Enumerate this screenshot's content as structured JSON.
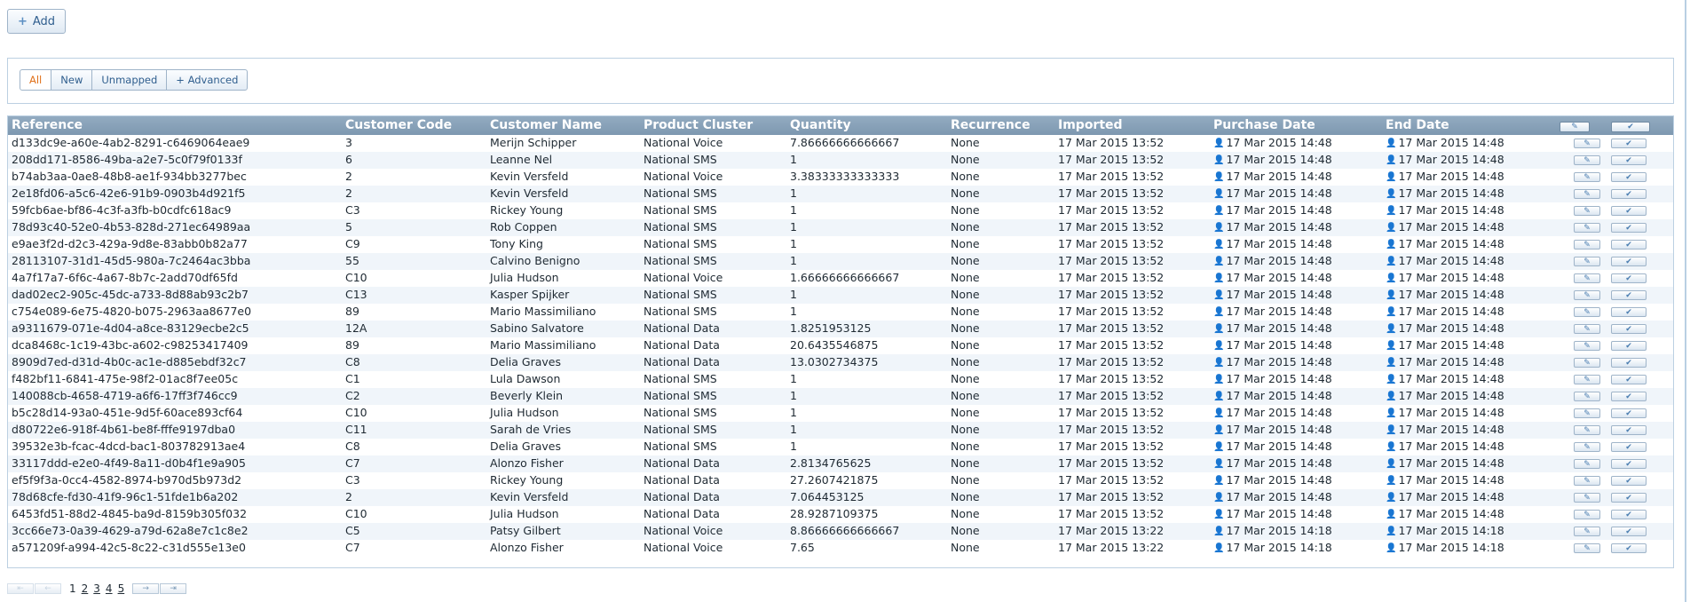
{
  "toolbar": {
    "add_label": "Add"
  },
  "filters": [
    {
      "label": "All",
      "active": true
    },
    {
      "label": "New",
      "active": false
    },
    {
      "label": "Unmapped",
      "active": false
    },
    {
      "label": "+ Advanced",
      "active": false
    }
  ],
  "table": {
    "columns": [
      "Reference",
      "Customer Code",
      "Customer Name",
      "Product Cluster",
      "Quantity",
      "Recurrence",
      "Imported",
      "Purchase Date",
      "End Date"
    ],
    "rows": [
      [
        "d133dc9e-a60e-4ab2-8291-c6469064eae9",
        "3",
        "Merijn Schipper",
        "National Voice",
        "7.86666666666667",
        "None",
        "17 Mar 2015 13:52",
        "17 Mar 2015 14:48",
        "17 Mar 2015 14:48"
      ],
      [
        "208dd171-8586-49ba-a2e7-5c0f79f0133f",
        "6",
        "Leanne Nel",
        "National SMS",
        "1",
        "None",
        "17 Mar 2015 13:52",
        "17 Mar 2015 14:48",
        "17 Mar 2015 14:48"
      ],
      [
        "b74ab3aa-0ae8-48b8-ae1f-934bb3277bec",
        "2",
        "Kevin Versfeld",
        "National Voice",
        "3.38333333333333",
        "None",
        "17 Mar 2015 13:52",
        "17 Mar 2015 14:48",
        "17 Mar 2015 14:48"
      ],
      [
        "2e18fd06-a5c6-42e6-91b9-0903b4d921f5",
        "2",
        "Kevin Versfeld",
        "National SMS",
        "1",
        "None",
        "17 Mar 2015 13:52",
        "17 Mar 2015 14:48",
        "17 Mar 2015 14:48"
      ],
      [
        "59fcb6ae-bf86-4c3f-a3fb-b0cdfc618ac9",
        "C3",
        "Rickey Young",
        "National SMS",
        "1",
        "None",
        "17 Mar 2015 13:52",
        "17 Mar 2015 14:48",
        "17 Mar 2015 14:48"
      ],
      [
        "78d93c40-52e0-4b53-828d-271ec64989aa",
        "5",
        "Rob Coppen",
        "National SMS",
        "1",
        "None",
        "17 Mar 2015 13:52",
        "17 Mar 2015 14:48",
        "17 Mar 2015 14:48"
      ],
      [
        "e9ae3f2d-d2c3-429a-9d8e-83abb0b82a77",
        "C9",
        "Tony King",
        "National SMS",
        "1",
        "None",
        "17 Mar 2015 13:52",
        "17 Mar 2015 14:48",
        "17 Mar 2015 14:48"
      ],
      [
        "28113107-31d1-45d5-980a-7c2464ac3bba",
        "55",
        "Calvino Benigno",
        "National SMS",
        "1",
        "None",
        "17 Mar 2015 13:52",
        "17 Mar 2015 14:48",
        "17 Mar 2015 14:48"
      ],
      [
        "4a7f17a7-6f6c-4a67-8b7c-2add70df65fd",
        "C10",
        "Julia Hudson",
        "National Voice",
        "1.66666666666667",
        "None",
        "17 Mar 2015 13:52",
        "17 Mar 2015 14:48",
        "17 Mar 2015 14:48"
      ],
      [
        "dad02ec2-905c-45dc-a733-8d88ab93c2b7",
        "C13",
        "Kasper Spijker",
        "National SMS",
        "1",
        "None",
        "17 Mar 2015 13:52",
        "17 Mar 2015 14:48",
        "17 Mar 2015 14:48"
      ],
      [
        "c754e089-6e75-4820-b075-2963aa8677e0",
        "89",
        "Mario Massimiliano",
        "National SMS",
        "1",
        "None",
        "17 Mar 2015 13:52",
        "17 Mar 2015 14:48",
        "17 Mar 2015 14:48"
      ],
      [
        "a9311679-071e-4d04-a8ce-83129ecbe2c5",
        "12A",
        "Sabino Salvatore",
        "National Data",
        "1.8251953125",
        "None",
        "17 Mar 2015 13:52",
        "17 Mar 2015 14:48",
        "17 Mar 2015 14:48"
      ],
      [
        "dca8468c-1c19-43bc-a602-c98253417409",
        "89",
        "Mario Massimiliano",
        "National Data",
        "20.6435546875",
        "None",
        "17 Mar 2015 13:52",
        "17 Mar 2015 14:48",
        "17 Mar 2015 14:48"
      ],
      [
        "8909d7ed-d31d-4b0c-ac1e-d885ebdf32c7",
        "C8",
        "Delia Graves",
        "National Data",
        "13.0302734375",
        "None",
        "17 Mar 2015 13:52",
        "17 Mar 2015 14:48",
        "17 Mar 2015 14:48"
      ],
      [
        "f482bf11-6841-475e-98f2-01ac8f7ee05c",
        "C1",
        "Lula Dawson",
        "National SMS",
        "1",
        "None",
        "17 Mar 2015 13:52",
        "17 Mar 2015 14:48",
        "17 Mar 2015 14:48"
      ],
      [
        "140088cb-4658-4719-a6f6-17ff3f746cc9",
        "C2",
        "Beverly Klein",
        "National SMS",
        "1",
        "None",
        "17 Mar 2015 13:52",
        "17 Mar 2015 14:48",
        "17 Mar 2015 14:48"
      ],
      [
        "b5c28d14-93a0-451e-9d5f-60ace893cf64",
        "C10",
        "Julia Hudson",
        "National SMS",
        "1",
        "None",
        "17 Mar 2015 13:52",
        "17 Mar 2015 14:48",
        "17 Mar 2015 14:48"
      ],
      [
        "d80722e6-918f-4b61-be8f-fffe9197dba0",
        "C11",
        "Sarah de Vries",
        "National SMS",
        "1",
        "None",
        "17 Mar 2015 13:52",
        "17 Mar 2015 14:48",
        "17 Mar 2015 14:48"
      ],
      [
        "39532e3b-fcac-4dcd-bac1-803782913ae4",
        "C8",
        "Delia Graves",
        "National SMS",
        "1",
        "None",
        "17 Mar 2015 13:52",
        "17 Mar 2015 14:48",
        "17 Mar 2015 14:48"
      ],
      [
        "33117ddd-e2e0-4f49-8a11-d0b4f1e9a905",
        "C7",
        "Alonzo Fisher",
        "National Data",
        "2.8134765625",
        "None",
        "17 Mar 2015 13:52",
        "17 Mar 2015 14:48",
        "17 Mar 2015 14:48"
      ],
      [
        "ef5f9f3a-0cc4-4582-8974-b970d5b973d2",
        "C3",
        "Rickey Young",
        "National Data",
        "27.2607421875",
        "None",
        "17 Mar 2015 13:52",
        "17 Mar 2015 14:48",
        "17 Mar 2015 14:48"
      ],
      [
        "78d68cfe-fd30-41f9-96c1-51fde1b6a202",
        "2",
        "Kevin Versfeld",
        "National Data",
        "7.064453125",
        "None",
        "17 Mar 2015 13:52",
        "17 Mar 2015 14:48",
        "17 Mar 2015 14:48"
      ],
      [
        "6453fd51-88d2-4845-ba9d-8159b305f032",
        "C10",
        "Julia Hudson",
        "National Data",
        "28.9287109375",
        "None",
        "17 Mar 2015 13:52",
        "17 Mar 2015 14:48",
        "17 Mar 2015 14:48"
      ],
      [
        "3cc66e73-0a39-4629-a79d-62a8e7c1c8e2",
        "C5",
        "Patsy Gilbert",
        "National Voice",
        "8.86666666666667",
        "None",
        "17 Mar 2015 13:22",
        "17 Mar 2015 14:18",
        "17 Mar 2015 14:18"
      ],
      [
        "a571209f-a994-42c5-8c22-c31d555e13e0",
        "C7",
        "Alonzo Fisher",
        "National Voice",
        "7.65",
        "None",
        "17 Mar 2015 13:22",
        "17 Mar 2015 14:18",
        "17 Mar 2015 14:18"
      ]
    ]
  },
  "pagination": {
    "current": "1",
    "pages": [
      "2",
      "3",
      "4",
      "5"
    ]
  },
  "icons": {
    "add": "plus-icon",
    "edit": "pencil-icon",
    "approve": "checkmark-icon",
    "person": "person-icon",
    "prev": "arrow-left-icon",
    "next": "arrow-right-icon"
  },
  "colors": {
    "header_bg": "#8aa3b9",
    "accent_link": "#2f5e8e",
    "active_filter": "#e0711b",
    "row_alt": "#f0f5fa"
  }
}
